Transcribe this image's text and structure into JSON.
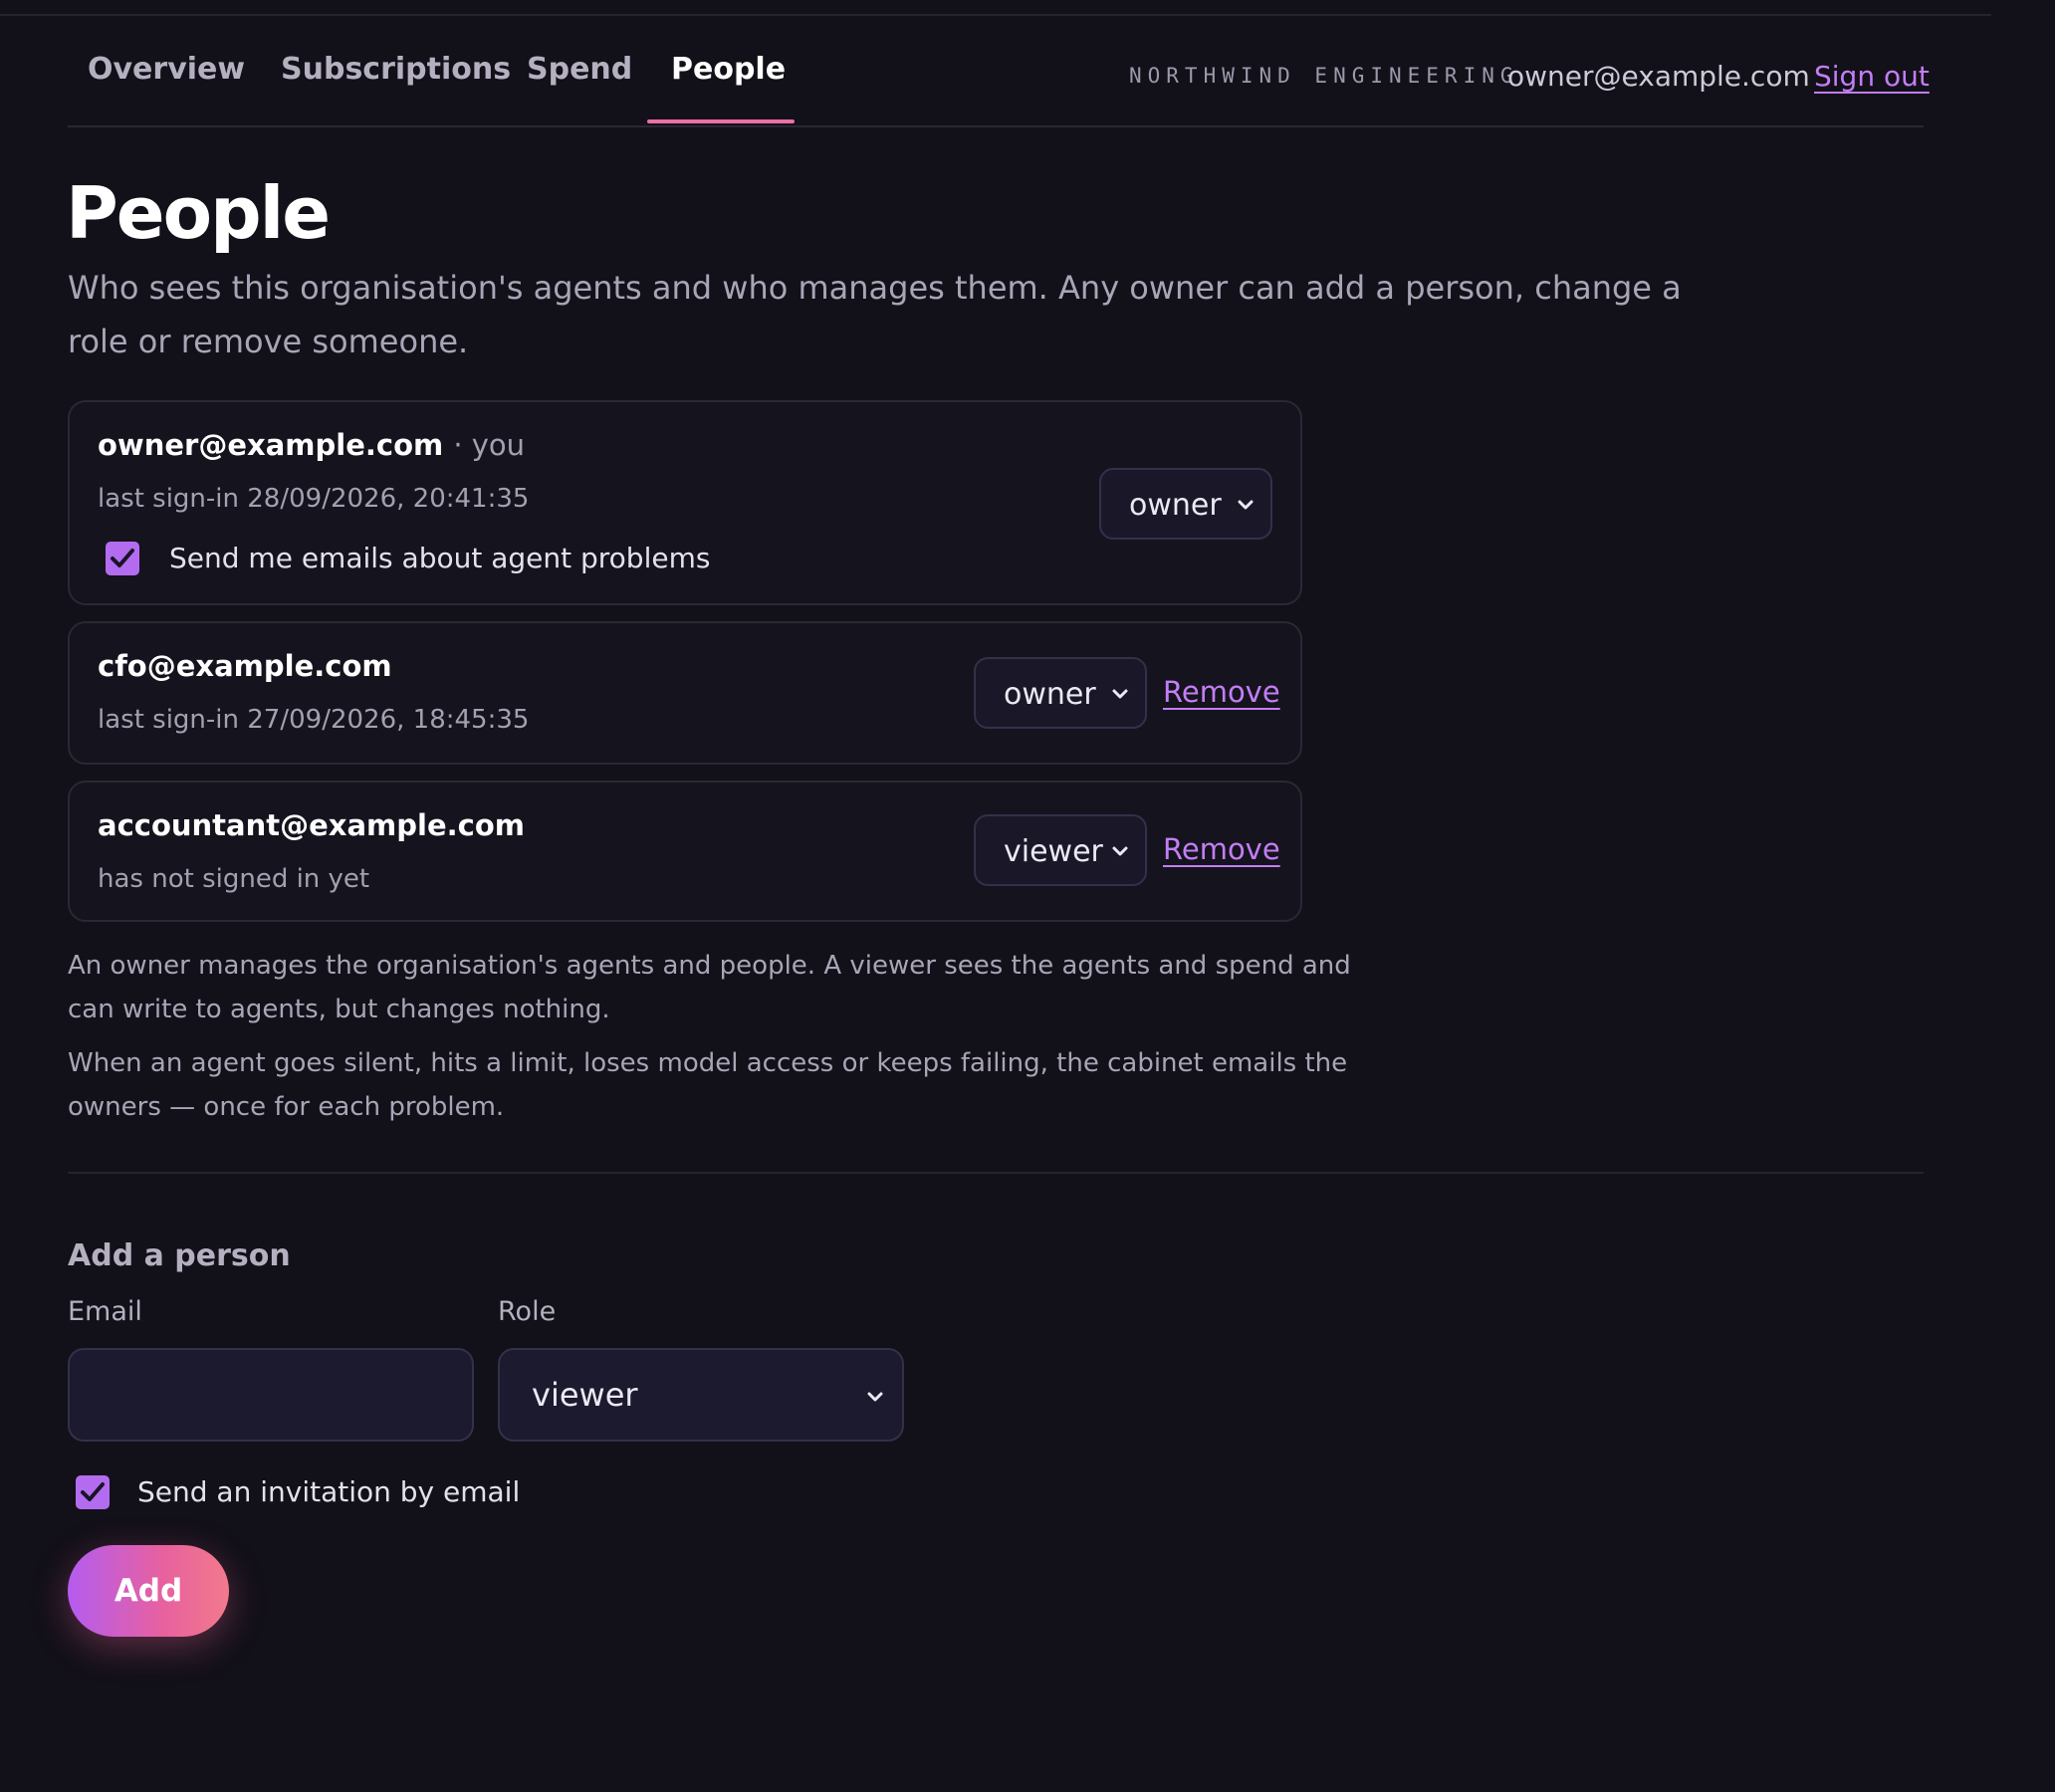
{
  "nav": {
    "tabs": [
      {
        "label": "Overview"
      },
      {
        "label": "Subscriptions"
      },
      {
        "label": "Spend"
      },
      {
        "label": "People"
      }
    ],
    "active_tab": "People",
    "org_name": "NORTHWIND ENGINEERING",
    "user_email": "owner@example.com",
    "sign_out_label": "Sign out"
  },
  "page": {
    "title": "People",
    "description": "Who sees this organisation's agents and who manages them. Any owner can add a person, change a role or remove someone."
  },
  "members": [
    {
      "email": "owner@example.com",
      "you_suffix": "· you",
      "last_signin": "last sign-in 28/09/2026, 20:41:35",
      "role": "owner",
      "notify_checked": true,
      "notify_label": "Send me emails about agent problems"
    },
    {
      "email": "cfo@example.com",
      "last_signin": "last sign-in 27/09/2026, 18:45:35",
      "role": "owner",
      "remove_label": "Remove"
    },
    {
      "email": "accountant@example.com",
      "last_signin": "has not signed in yet",
      "role": "viewer",
      "remove_label": "Remove"
    }
  ],
  "notes": {
    "roles": "An owner manages the organisation's agents and people. A viewer sees the agents and spend and can write to agents, but changes nothing.",
    "alerts": "When an agent goes silent, hits a limit, loses model access or keeps failing, the cabinet emails the owners — once for each problem."
  },
  "add_person": {
    "title": "Add a person",
    "email_label": "Email",
    "email_value": "",
    "role_label": "Role",
    "role_value": "viewer",
    "invite_checked": true,
    "invite_label": "Send an invitation by email",
    "add_label": "Add"
  },
  "colors": {
    "background": "#121019",
    "accent": "#c27ef5",
    "active_tab_underline": "#ec6fa8",
    "checkbox": "#b36cf0"
  }
}
